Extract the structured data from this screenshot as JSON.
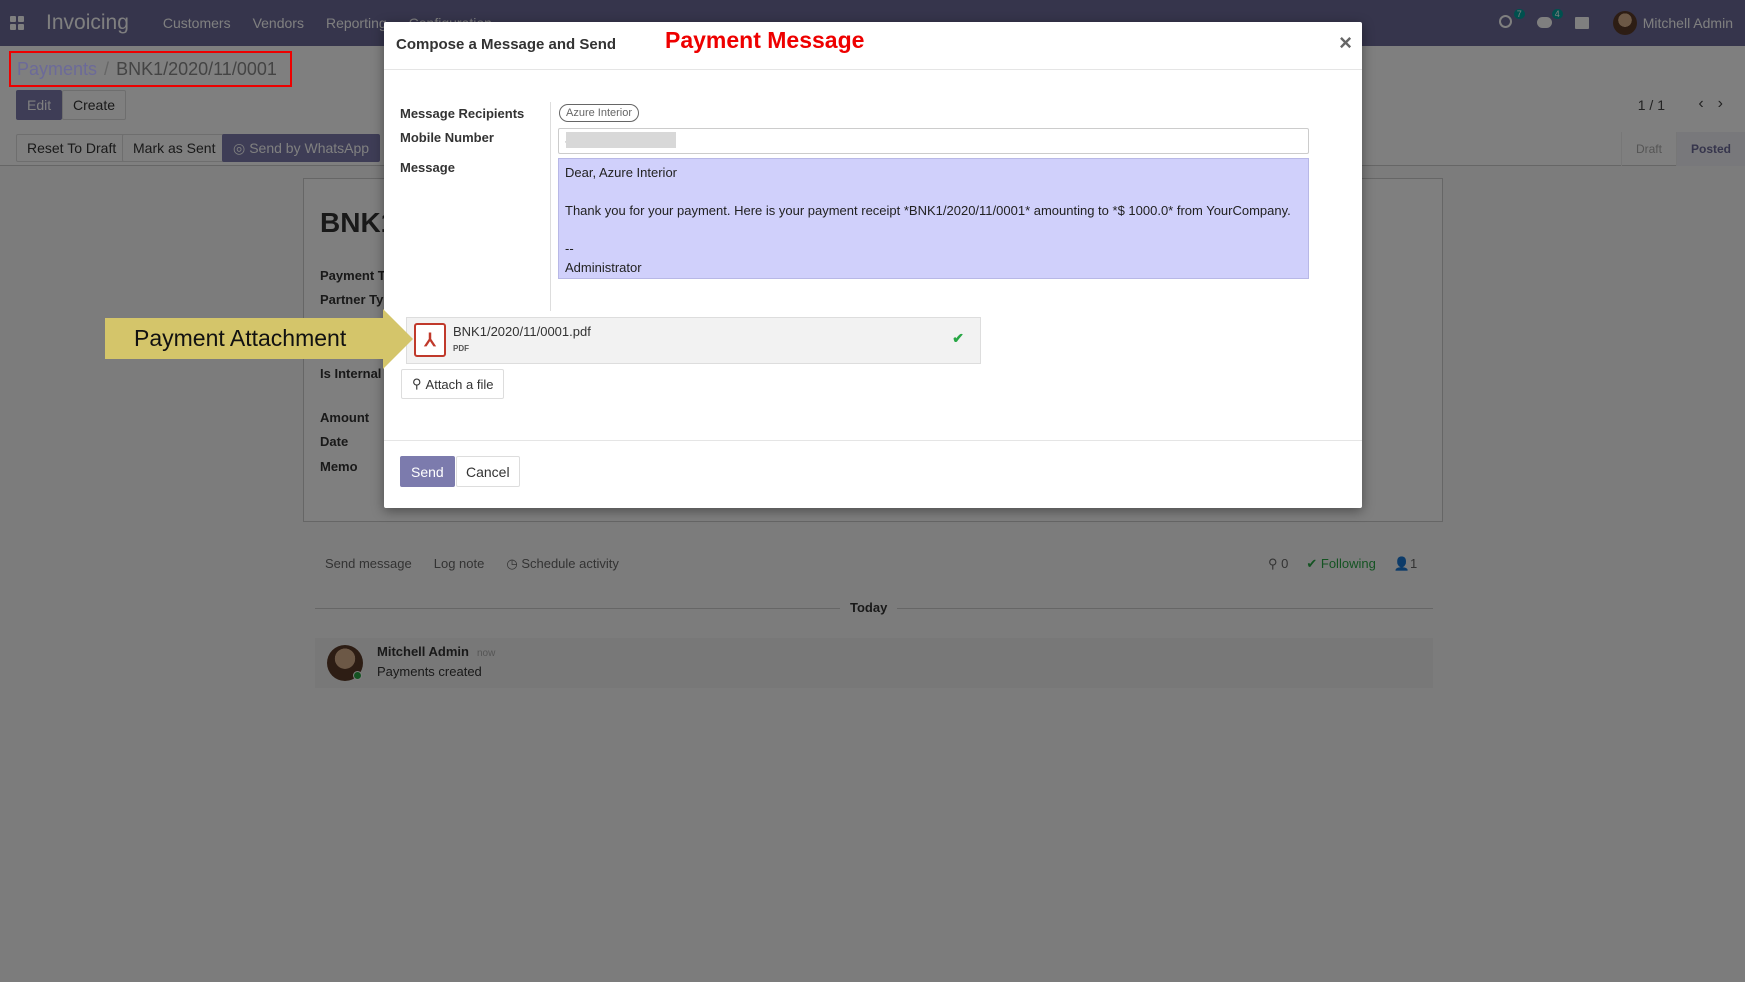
{
  "navbar": {
    "app_name": "Invoicing",
    "menu": [
      "Customers",
      "Vendors",
      "Reporting",
      "Configuration"
    ],
    "activity_count": "7",
    "message_count": "4",
    "user_name": "Mitchell Admin"
  },
  "breadcrumb": {
    "parent": "Payments",
    "separator": "/",
    "current": "BNK1/2020/11/0001"
  },
  "control_panel": {
    "edit_label": "Edit",
    "create_label": "Create",
    "pager": "1 / 1"
  },
  "actions": {
    "reset_label": "Reset To Draft",
    "mark_sent_label": "Mark as Sent",
    "whatsapp_label": "Send by WhatsApp"
  },
  "status": {
    "steps": [
      "Draft",
      "Posted"
    ],
    "active": "Posted"
  },
  "sheet": {
    "title": "BNK1",
    "labels": [
      "Payment T",
      "Partner Ty",
      "Is Internal",
      "Amount",
      "Date",
      "Memo"
    ]
  },
  "chatter": {
    "send_message": "Send message",
    "log_note": "Log note",
    "schedule": "Schedule activity",
    "attachments_count": "0",
    "following": "Following",
    "followers_count": "1",
    "today": "Today",
    "message": {
      "author": "Mitchell Admin",
      "time": "now",
      "body": "Payments created"
    }
  },
  "modal": {
    "title": "Compose a Message and Send",
    "annotation": "Payment Message",
    "close_symbol": "×",
    "recipients_label": "Message Recipients",
    "recipient": "Azure Interior",
    "mobile_label": "Mobile Number",
    "mobile_value": "+",
    "message_label": "Message",
    "message_lines": [
      "Dear, Azure Interior",
      "",
      "Thank you for your payment. Here is your payment receipt *BNK1/2020/11/0001* amounting to *$ 1000.0* from YourCompany.",
      "",
      "--",
      "Administrator"
    ],
    "attachment": {
      "name": "BNK1/2020/11/0001.pdf",
      "ext": "PDF"
    },
    "attach_label": "Attach a file",
    "send_label": "Send",
    "cancel_label": "Cancel"
  },
  "callout": {
    "text": "Payment Attachment",
    "color": "#d4c56a"
  },
  "colors": {
    "brand": "#6c6a99",
    "primary": "#7c7bad",
    "annotation_red": "#e00000",
    "message_bg": "#d0d0fb",
    "success": "#28a745"
  }
}
